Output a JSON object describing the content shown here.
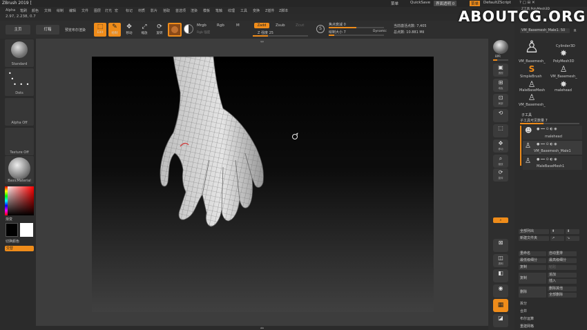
{
  "titlebar": {
    "title": "ZBrush 2019 [",
    "right_label_1": "菜单",
    "quicksave": "QuickSave",
    "interface_transparency": "界面透明 0",
    "menus_btn": "菜单",
    "script": "DefaultZScript",
    "help_icons": "? ▢ ⊟ ✕"
  },
  "menubar": {
    "items": [
      "Alpha",
      "笔刷",
      "颜色",
      "文档",
      "绘制",
      "编辑",
      "文件",
      "图层",
      "灯光",
      "宏",
      "标记",
      "材质",
      "影片",
      "拾取",
      "首选项",
      "渲染",
      "模板",
      "笔触",
      "纹理",
      "工具",
      "变换",
      "Z插件",
      "Z脚本"
    ]
  },
  "coords": "2.97, 2.238, 0.7",
  "toolbar": {
    "home": "主页",
    "lightbox": "灯箱",
    "live_boolean": "预览布尔渲染",
    "edit": "Edit",
    "draw": "绘制",
    "move": "移动",
    "scale": "缩放",
    "rotate": "旋转",
    "mrgb": "Mrgb",
    "rgb": "Rgb",
    "m": "M",
    "rgb_intensity": "Rgb 强度",
    "zadd": "Zadd",
    "zsub": "Zsub",
    "zcut": "Zcut",
    "z_intensity": "Z 强度 25",
    "focal_shift": "焦点衰减 0",
    "draw_size": "绘制大小 7",
    "dynamic": "Dynamic",
    "active_points": "当前激活点数: 7,405",
    "total_points": "总点数: 10.881 Mil"
  },
  "left_shelf": {
    "standard": "Standard",
    "dots": "Dots",
    "alpha_off": "Alpha Off",
    "texture_off": "Texture Off",
    "basic_material": "BasicMaterial",
    "gradient": "渐变",
    "switch_color": "切换颜色",
    "alternate": "交替"
  },
  "right_shelf": {
    "buttons": [
      "透视",
      "地板",
      "局部",
      "移动",
      "缩放",
      "旋转",
      "线框",
      "透明",
      "实体",
      "解冻"
    ],
    "bpr": "BPR",
    "spix": "SPix"
  },
  "panel": {
    "top_label": "Z工具 PolyMesh3D",
    "current_tool": "VM_Basemesh_Male1. 50",
    "scale_label": "R",
    "meshes": [
      "VM_Basemesh_",
      "PolyMesh3D",
      "SimpleBrush",
      "VM_Basemesh_",
      "MaleBaseMesh",
      "malehead",
      "VM_Basemesh_"
    ],
    "cylinder": "Cylinder3D",
    "subtool_header": "子工具",
    "subtool_count": "子工具可见数量 7",
    "subtools": [
      "malehead",
      "VM_Basemesh_Male1",
      "MaleBaseMesh1"
    ],
    "list_all": "全部列出",
    "new_folder": "新建文件夹",
    "rename": "重命名",
    "auto_reorder": "自动重排",
    "all_low": "最低级细分",
    "all_high": "最高级细分",
    "copy": "复制",
    "paste": "粘贴",
    "duplicate": "复制",
    "append": "追加",
    "insert": "插入",
    "delete": "删除",
    "del_other": "删除其他",
    "del_all": "全部删除",
    "split": "拆分",
    "merge": "合并",
    "boolean": "布尔运算",
    "remesh": "重建网格"
  },
  "watermark": "ABOUTCG.ORG",
  "colors": {
    "accent": "#ef8c1a",
    "bg": "#2b2b2b"
  }
}
